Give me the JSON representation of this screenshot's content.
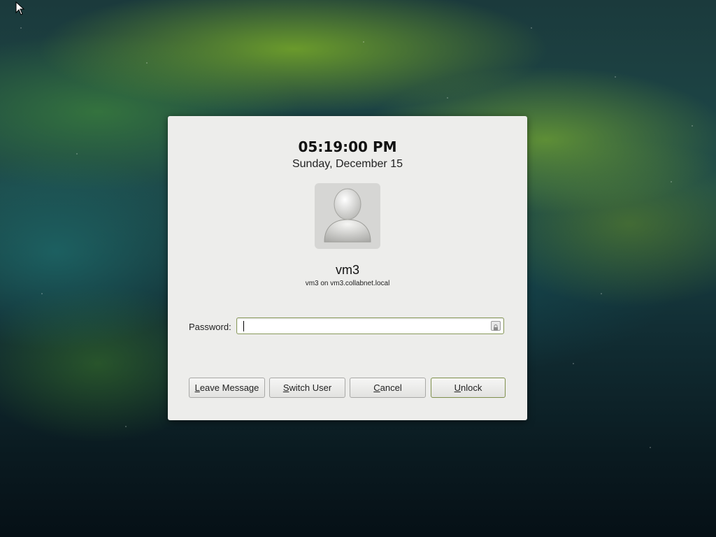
{
  "lock_dialog": {
    "time": "05:19:00 PM",
    "date": "Sunday, December 15",
    "user": {
      "name": "vm3",
      "host_line": "vm3 on vm3.collabnet.local",
      "avatar_icon": "user-avatar-icon"
    },
    "password": {
      "label": "Password:",
      "value": "",
      "trailing_icon": "keyboard-lock-icon"
    },
    "buttons": {
      "leave_message": {
        "mnemonic": "L",
        "rest": "eave Message"
      },
      "switch_user": {
        "mnemonic": "S",
        "rest": "witch User"
      },
      "cancel": {
        "mnemonic": "C",
        "rest": "ancel"
      },
      "unlock": {
        "mnemonic": "U",
        "rest": "nlock"
      }
    }
  },
  "colors": {
    "dialog_bg": "#ededeb",
    "default_button_border": "#7f8f4c",
    "focus_border": "#8a9a5b"
  },
  "desktop": {
    "cursor_icon": "mouse-pointer-icon"
  }
}
